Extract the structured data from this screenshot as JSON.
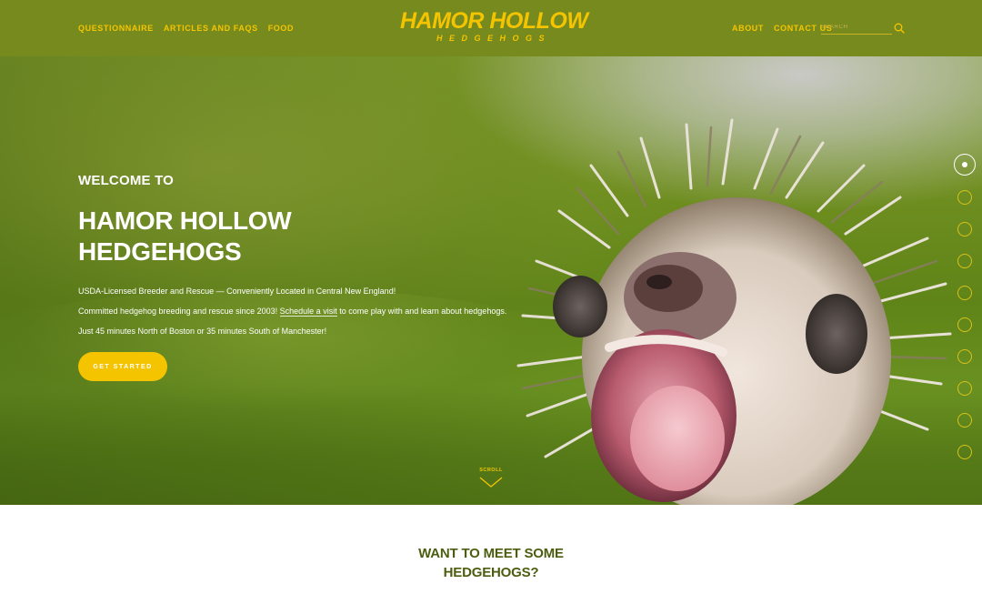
{
  "header": {
    "nav_left": [
      "QUESTIONNAIRE",
      "ARTICLES AND FAQS",
      "FOOD"
    ],
    "logo_title": "HAMOR HOLLOW",
    "logo_subtitle": "HEDGEHOGS",
    "nav_right": [
      "ABOUT",
      "CONTACT US"
    ],
    "search_placeholder": "SEARCH",
    "search_icon": "search-icon"
  },
  "hero": {
    "welcome": "WELCOME TO",
    "title_line1": "HAMOR HOLLOW",
    "title_line2": "HEDGEHOGS",
    "line1": "USDA-Licensed Breeder and Rescue — Conveniently Located in Central New England!",
    "line2_before": "Committed hedgehog breeding and rescue since 2003! ",
    "line2_link": "Schedule a visit",
    "line2_after": " to come play with and learn about hedgehogs.",
    "line3": "Just 45 minutes North of Boston or 35 minutes South of Manchester!",
    "cta_label": "GET STARTED",
    "scroll_label": "SCROLL",
    "scroll_icon": "chevron-down-icon",
    "slides": {
      "count": 10,
      "active_index": 0
    }
  },
  "section": {
    "title_line1": "WANT TO MEET SOME",
    "title_line2": "HEDGEHOGS?"
  },
  "colors": {
    "header_bg": "#768a1e",
    "accent": "#f5c400",
    "section_title": "#4d5d10"
  }
}
